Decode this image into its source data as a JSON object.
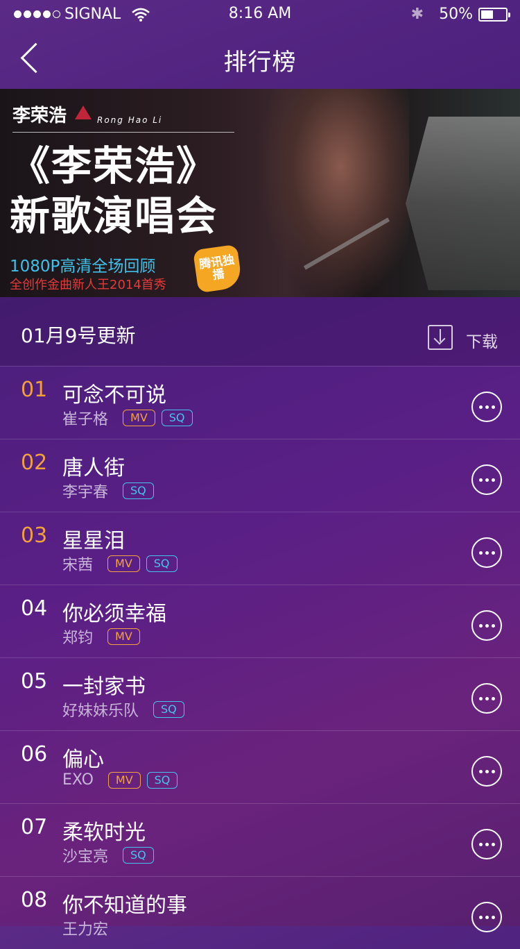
{
  "status": {
    "carrier": "SIGNAL",
    "time": "8:16 AM",
    "battery": "50%",
    "battery_level": 0.5
  },
  "nav": {
    "title": "排行榜"
  },
  "banner": {
    "artist_cn": "李荣浩",
    "artist_en": "Rong Hao Li",
    "headline1": "《李荣浩》",
    "headline2": "新歌演唱会",
    "sub1": "1080P高清全场回顾",
    "sub2": "全创作金曲新人王2014首秀",
    "badge": "腾讯独播"
  },
  "header": {
    "update_label": "01月9号更新",
    "download_label": "下载"
  },
  "songs": [
    {
      "rank": "01",
      "title": "可念不可说",
      "artist": "崔子格",
      "mv": "MV",
      "sq": "SQ"
    },
    {
      "rank": "02",
      "title": "唐人街",
      "artist": "李宇春",
      "mv": "",
      "sq": "SQ"
    },
    {
      "rank": "03",
      "title": "星星泪",
      "artist": "宋茜",
      "mv": "MV",
      "sq": "SQ"
    },
    {
      "rank": "04",
      "title": "你必须幸福",
      "artist": "郑钧",
      "mv": "MV",
      "sq": ""
    },
    {
      "rank": "05",
      "title": "一封家书",
      "artist": "好妹妹乐队",
      "mv": "",
      "sq": "SQ"
    },
    {
      "rank": "06",
      "title": "偏心",
      "artist": "EXO",
      "mv": "MV",
      "sq": "SQ"
    },
    {
      "rank": "07",
      "title": "柔软时光",
      "artist": "沙宝亮",
      "mv": "",
      "sq": "SQ"
    },
    {
      "rank": "08",
      "title": "你不知道的事",
      "artist": "王力宏",
      "mv": "",
      "sq": ""
    }
  ],
  "colors": {
    "accent_rank": "#f1a03c",
    "mv_tag": "#f3a33f",
    "sq_tag": "#48c3ee"
  }
}
